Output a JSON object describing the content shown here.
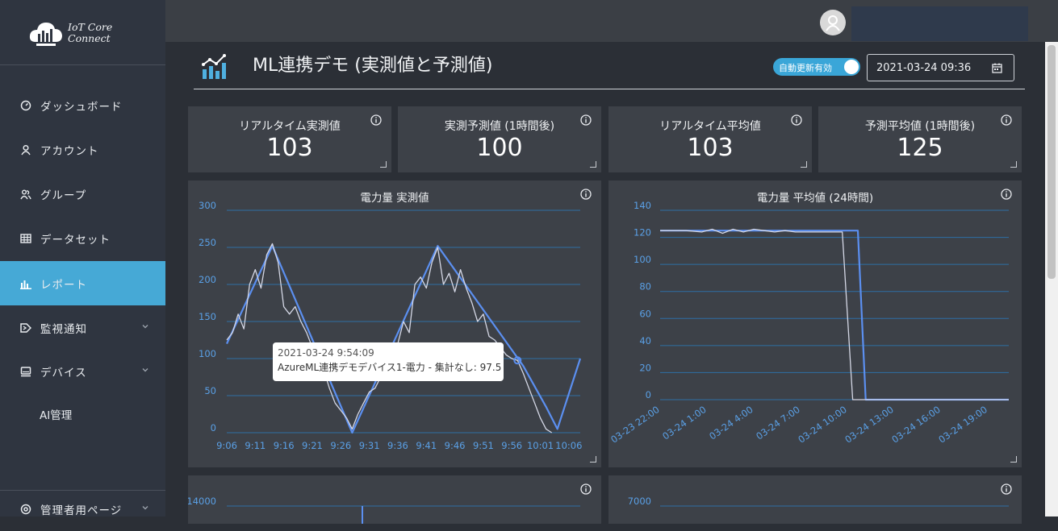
{
  "logo": {
    "line1": "IoT Core",
    "line2": "Connect"
  },
  "sidebar": {
    "items": [
      {
        "label": "ダッシュボード",
        "icon": "dashboard-icon",
        "active": false
      },
      {
        "label": "アカウント",
        "icon": "user-icon",
        "active": false
      },
      {
        "label": "グループ",
        "icon": "group-icon",
        "active": false
      },
      {
        "label": "データセット",
        "icon": "table-icon",
        "active": false
      },
      {
        "label": "レポート",
        "icon": "bar-chart-icon",
        "active": true
      },
      {
        "label": "監視通知",
        "icon": "monitor-icon",
        "active": false,
        "expandable": true
      },
      {
        "label": "デバイス",
        "icon": "device-icon",
        "active": false,
        "expandable": true
      },
      {
        "label": "AI管理",
        "icon": "",
        "active": false
      }
    ],
    "admin": {
      "label": "管理者用ページ",
      "icon": "settings-icon",
      "expandable": true
    }
  },
  "header": {
    "title": "ML連携デモ (実測値と予測値)",
    "auto_update_label": "自動更新有効",
    "auto_update_on": true,
    "datetime": "2021-03-24 09:36"
  },
  "stat_cards": [
    {
      "title": "リアルタイム実測値",
      "value": "103"
    },
    {
      "title": "実測予測値 (1時間後)",
      "value": "100"
    },
    {
      "title": "リアルタイム平均値",
      "value": "103"
    },
    {
      "title": "予測平均値 (1時間後)",
      "value": "125"
    }
  ],
  "colors": {
    "accent": "#46a9d6",
    "series_actual": "#5b8ff0",
    "series_predicted": "#d5d8e6",
    "gridline": "#2e6fa5",
    "axis_label": "#5aa0e6"
  },
  "tooltip": {
    "date": "2021-03-24 9:54:09",
    "text": "AzureML連携デモデバイス1-電力 - 集計なし: 97.5"
  },
  "chart_data": [
    {
      "type": "line",
      "title": "電力量 実測値",
      "x": [
        "9:06",
        "9:11",
        "9:16",
        "9:21",
        "9:26",
        "9:31",
        "9:36",
        "9:41",
        "9:46",
        "9:51",
        "9:56",
        "10:01",
        "10:06"
      ],
      "ylim": [
        0,
        300
      ],
      "yticks": [
        0,
        50,
        100,
        150,
        200,
        250,
        300
      ],
      "grid": true,
      "series": [
        {
          "values": [
            [
              0,
              125
            ],
            [
              0.5,
              135
            ],
            [
              1,
              160
            ],
            [
              1.5,
              140
            ],
            [
              2,
              200
            ],
            [
              2.5,
              220
            ],
            [
              3,
              195
            ],
            [
              3.5,
              240
            ],
            [
              4,
              255
            ],
            [
              4.5,
              230
            ],
            [
              5,
              170
            ],
            [
              5.5,
              160
            ],
            [
              6,
              170
            ],
            [
              6.5,
              150
            ],
            [
              7,
              135
            ],
            [
              7.5,
              115
            ],
            [
              8,
              100
            ],
            [
              8.5,
              85
            ],
            [
              9,
              60
            ],
            [
              9.5,
              40
            ],
            [
              10,
              30
            ],
            [
              10.5,
              20
            ],
            [
              11,
              5
            ],
            [
              11.5,
              25
            ],
            [
              12,
              40
            ],
            [
              12.5,
              55
            ],
            [
              13,
              60
            ],
            [
              13.5,
              75
            ],
            [
              14,
              90
            ],
            [
              14.5,
              110
            ],
            [
              15,
              120
            ],
            [
              15.5,
              150
            ],
            [
              16,
              135
            ],
            [
              16.5,
              200
            ],
            [
              17,
              210
            ],
            [
              17.5,
              195
            ],
            [
              18,
              230
            ],
            [
              18.5,
              250
            ],
            [
              19,
              200
            ],
            [
              19.5,
              215
            ],
            [
              20,
              190
            ],
            [
              20.5,
              220
            ],
            [
              21,
              195
            ],
            [
              21.5,
              175
            ],
            [
              22,
              150
            ],
            [
              22.5,
              160
            ],
            [
              23,
              130
            ],
            [
              23.5,
              125
            ],
            [
              24,
              115
            ],
            [
              24.5,
              105
            ],
            [
              25,
              100
            ],
            [
              25.5,
              97.5
            ],
            [
              26,
              80
            ],
            [
              26.5,
              60
            ],
            [
              27,
              40
            ],
            [
              27.5,
              20
            ],
            [
              28,
              5
            ],
            [
              28.5,
              0
            ]
          ]
        },
        {
          "values": [
            [
              0,
              120
            ],
            [
              4,
              252
            ],
            [
              11,
              0
            ],
            [
              18.5,
              252
            ],
            [
              26,
              90
            ],
            [
              28,
              35
            ],
            [
              29,
              5
            ],
            [
              31,
              100
            ]
          ]
        }
      ]
    },
    {
      "type": "line",
      "title": "電力量 平均値 (24時間)",
      "x": [
        "03-23 22:00",
        "03-24 1:00",
        "03-24 4:00",
        "03-24 7:00",
        "03-24 10:00",
        "03-24 13:00",
        "03-24 16:00",
        "03-24 19:00"
      ],
      "ylim": [
        0,
        140
      ],
      "yticks": [
        0,
        20,
        40,
        60,
        80,
        100,
        120,
        140
      ],
      "grid": true,
      "series": [
        {
          "values": [
            [
              0,
              125
            ],
            [
              1,
              125
            ],
            [
              1.6,
              124
            ],
            [
              2,
              126
            ],
            [
              2.4,
              123
            ],
            [
              2.8,
              126
            ],
            [
              3.2,
              124
            ],
            [
              3.6,
              126
            ],
            [
              4,
              125
            ],
            [
              4.4,
              124
            ],
            [
              4.8,
              125
            ],
            [
              5.2,
              124
            ],
            [
              5.6,
              124
            ],
            [
              6.0,
              124
            ],
            [
              6.4,
              124
            ],
            [
              6.8,
              124
            ],
            [
              7.0,
              124
            ],
            [
              7.4,
              0
            ],
            [
              8,
              0
            ],
            [
              11,
              0
            ],
            [
              13.4,
              0
            ]
          ]
        },
        {
          "values": [
            [
              0,
              125
            ],
            [
              4,
              125
            ],
            [
              7.6,
              125
            ],
            [
              7.9,
              0
            ],
            [
              13.4,
              0
            ]
          ]
        }
      ]
    },
    {
      "type": "line",
      "title": "",
      "ylabel": "",
      "yticks": [
        14000
      ],
      "partial": true
    },
    {
      "type": "line",
      "title": "",
      "ylabel": "",
      "yticks": [
        7000
      ],
      "partial": true
    }
  ]
}
